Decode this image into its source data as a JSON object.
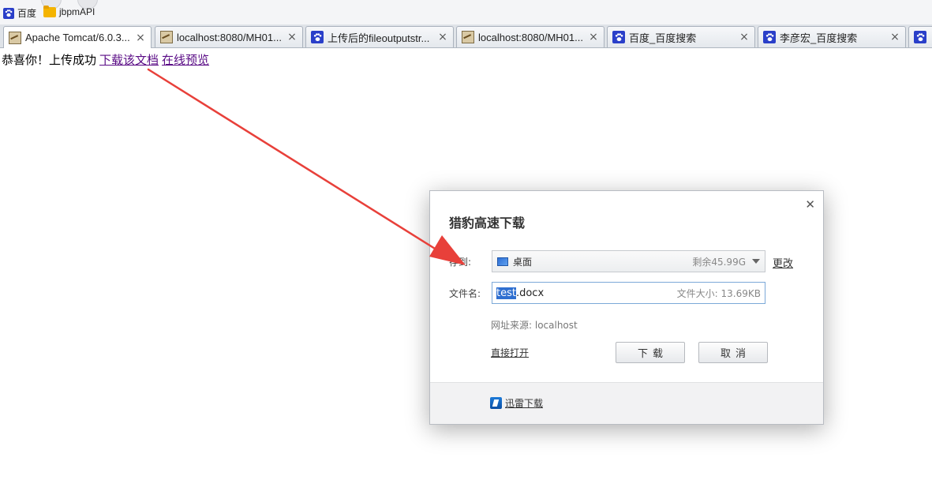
{
  "bookmarks": [
    {
      "label": "百度",
      "icon": "baidu-paw-icon"
    },
    {
      "label": "jbpmAPI",
      "icon": "folder-icon"
    }
  ],
  "tabs": [
    {
      "title": "Apache Tomcat/6.0.3...",
      "icon": "tomcat-icon",
      "active": true
    },
    {
      "title": "localhost:8080/MH01...",
      "icon": "tomcat-icon"
    },
    {
      "title": "上传后的fileoutputstr...",
      "icon": "baidu-paw-icon"
    },
    {
      "title": "localhost:8080/MH01...",
      "icon": "tomcat-icon"
    },
    {
      "title": "百度_百度搜索",
      "icon": "baidu-paw-icon"
    },
    {
      "title": "李彦宏_百度搜索",
      "icon": "baidu-paw-icon"
    }
  ],
  "page": {
    "message": "恭喜你！上传成功",
    "download_link": "下载该文档",
    "preview_link": "在线预览"
  },
  "dialog": {
    "title": "猎豹高速下载",
    "save_to_label": "存到:",
    "location": "桌面",
    "free_space": "剩余45.99G",
    "change_link": "更改",
    "filename_label": "文件名:",
    "filename_selected": "test",
    "filename_rest": ".docx",
    "file_size": "文件大小: 13.69KB",
    "source": "网址来源: localhost",
    "open_directly": "直接打开",
    "download_button": "下载",
    "cancel_button": "取消",
    "thunder_link": "迅雷下载"
  },
  "colors": {
    "arrow": "#e8403a",
    "link_visited": "#5a0c86",
    "selection": "#2f6fd0"
  }
}
